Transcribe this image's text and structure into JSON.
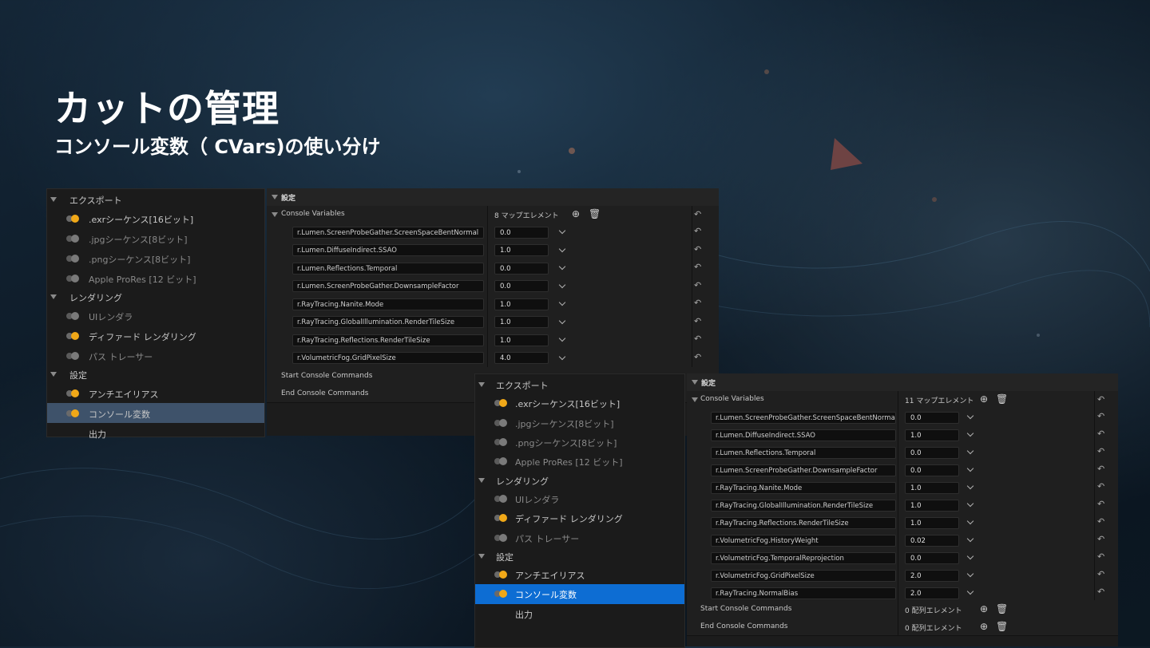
{
  "slide": {
    "title": "カットの管理",
    "subtitle": "コンソール変数（ CVars)の使い分け"
  },
  "left_tree": {
    "groups": [
      {
        "label": "エクスポート",
        "items": [
          {
            "label": ".exrシーケンス[16ビット]",
            "enabled": true
          },
          {
            "label": ".jpgシーケンス[8ビット]",
            "enabled": false
          },
          {
            "label": ".pngシーケンス[8ビット]",
            "enabled": false
          },
          {
            "label": "Apple ProRes [12 ビット]",
            "enabled": false
          }
        ]
      },
      {
        "label": "レンダリング",
        "items": [
          {
            "label": "UIレンダラ",
            "enabled": false
          },
          {
            "label": "ディファード レンダリング",
            "enabled": true
          },
          {
            "label": "パス トレーサー",
            "enabled": false
          }
        ]
      },
      {
        "label": "設定",
        "items": [
          {
            "label": "アンチエイリアス",
            "enabled": true
          },
          {
            "label": "コンソール変数",
            "enabled": true,
            "selected": true
          },
          {
            "label": "出力",
            "enabled": null
          }
        ]
      }
    ]
  },
  "settings_a": {
    "header": "設定",
    "console_variables_label": "Console Variables",
    "count_label": "8 マップエレメント",
    "rows": [
      {
        "name": "r.Lumen.ScreenProbeGather.ScreenSpaceBentNormal",
        "value": "0.0"
      },
      {
        "name": "r.Lumen.DiffuseIndirect.SSAO",
        "value": "1.0"
      },
      {
        "name": "r.Lumen.Reflections.Temporal",
        "value": "0.0"
      },
      {
        "name": "r.Lumen.ScreenProbeGather.DownsampleFactor",
        "value": "0.0"
      },
      {
        "name": "r.RayTracing.Nanite.Mode",
        "value": "1.0"
      },
      {
        "name": "r.RayTracing.GlobalIllumination.RenderTileSize",
        "value": "1.0"
      },
      {
        "name": "r.RayTracing.Reflections.RenderTileSize",
        "value": "1.0"
      },
      {
        "name": "r.VolumetricFog.GridPixelSize",
        "value": "4.0"
      }
    ],
    "start_label": "Start Console Commands",
    "end_label": "End Console Commands"
  },
  "right_tree": {
    "groups": [
      {
        "label": "エクスポート",
        "items": [
          {
            "label": ".exrシーケンス[16ビット]",
            "enabled": true
          },
          {
            "label": ".jpgシーケンス[8ビット]",
            "enabled": false
          },
          {
            "label": ".pngシーケンス[8ビット]",
            "enabled": false
          },
          {
            "label": "Apple ProRes [12 ビット]",
            "enabled": false
          }
        ]
      },
      {
        "label": "レンダリング",
        "items": [
          {
            "label": "UIレンダラ",
            "enabled": false
          },
          {
            "label": "ディファード レンダリング",
            "enabled": true
          },
          {
            "label": "パス トレーサー",
            "enabled": false
          }
        ]
      },
      {
        "label": "設定",
        "items": [
          {
            "label": "アンチエイリアス",
            "enabled": true
          },
          {
            "label": "コンソール変数",
            "enabled": true,
            "selected": true
          },
          {
            "label": "出力",
            "enabled": null
          }
        ]
      }
    ]
  },
  "settings_b": {
    "header": "設定",
    "console_variables_label": "Console Variables",
    "count_label": "11 マップエレメント",
    "rows": [
      {
        "name": "r.Lumen.ScreenProbeGather.ScreenSpaceBentNormal",
        "value": "0.0"
      },
      {
        "name": "r.Lumen.DiffuseIndirect.SSAO",
        "value": "1.0"
      },
      {
        "name": "r.Lumen.Reflections.Temporal",
        "value": "0.0"
      },
      {
        "name": "r.Lumen.ScreenProbeGather.DownsampleFactor",
        "value": "0.0"
      },
      {
        "name": "r.RayTracing.Nanite.Mode",
        "value": "1.0"
      },
      {
        "name": "r.RayTracing.GlobalIllumination.RenderTileSize",
        "value": "1.0"
      },
      {
        "name": "r.RayTracing.Reflections.RenderTileSize",
        "value": "1.0"
      },
      {
        "name": "r.VolumetricFog.HistoryWeight",
        "value": "0.02"
      },
      {
        "name": "r.VolumetricFog.TemporalReprojection",
        "value": "0.0"
      },
      {
        "name": "r.VolumetricFog.GridPixelSize",
        "value": "2.0"
      },
      {
        "name": "r.RayTracing.NormalBias",
        "value": "2.0"
      }
    ],
    "start_label": "Start Console Commands",
    "start_count": "0 配列エレメント",
    "end_label": "End Console Commands",
    "end_count": "0 配列エレメント"
  },
  "icons": {
    "expand": "triangle-down-icon",
    "add": "plus-circle-icon",
    "delete": "trash-icon",
    "reset": "reset-arrow-icon",
    "dropdown": "chevron-down-icon",
    "toggle": "toggle-switch-icon"
  },
  "colors": {
    "toggle_on": "#f0a818",
    "selected_row_a": "#3e526a",
    "selected_row_b": "#0d6dd3",
    "panel_bg": "#1b1b1b"
  }
}
